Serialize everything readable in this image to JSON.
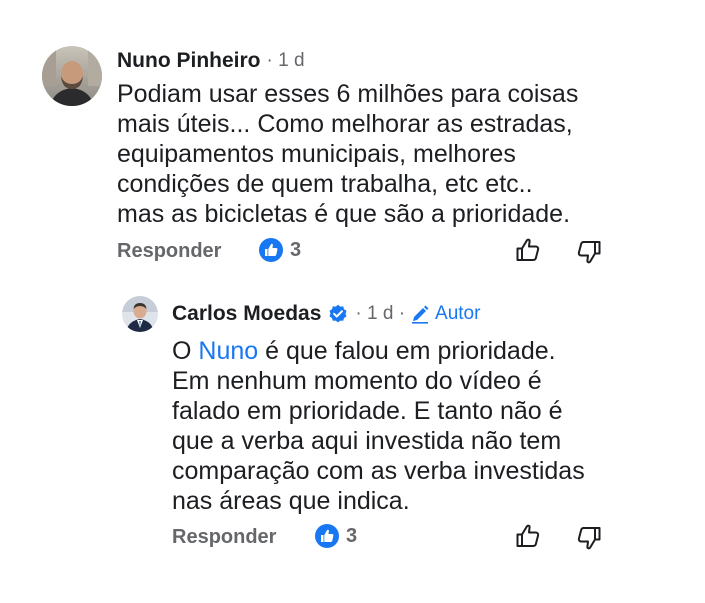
{
  "comment1": {
    "author": "Nuno Pinheiro",
    "meta": "· 1 d",
    "lines": [
      "Podiam usar esses 6 milhões para coisas",
      "mais úteis... Como melhorar as estradas,",
      "equipamentos municipais, melhores",
      "condições de quem trabalha, etc etc..",
      "mas as bicicletas é que são a prioridade."
    ],
    "reply_label": "Responder",
    "like_count": "3",
    "like_icon": "thumbs-up-badge-icon"
  },
  "comment2": {
    "author": "Carlos Moedas",
    "verified_icon": "verified-badge-icon",
    "meta": "· 1 d ·",
    "author_tag": "Autor",
    "line1_prefix": "O ",
    "mention": "Nuno",
    "line1_suffix": " é que falou em prioridade.",
    "lines": [
      "Em nenhum momento do vídeo é",
      "falado em prioridade. E tanto não é",
      "que a verba aqui investida não tem",
      "comparação com as verba investidas",
      "nas áreas que indica."
    ],
    "reply_label": "Responder",
    "like_count": "3"
  },
  "colors": {
    "accent": "#1877f2",
    "secondary_text": "#65676b",
    "primary_text": "#1c1e21"
  }
}
